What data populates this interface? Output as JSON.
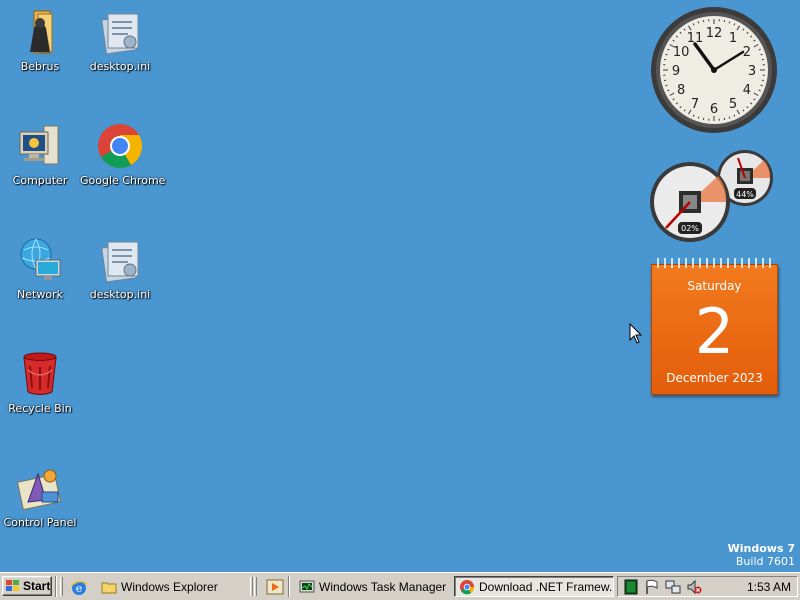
{
  "desktop_icons": [
    {
      "label": "Bebrus",
      "icon": "user-folder-icon"
    },
    {
      "label": "desktop.ini",
      "icon": "config-file-icon"
    },
    {
      "label": "Computer",
      "icon": "computer-icon"
    },
    {
      "label": "Google Chrome",
      "icon": "chrome-icon"
    },
    {
      "label": "Network",
      "icon": "network-icon"
    },
    {
      "label": "desktop.ini",
      "icon": "config-file-icon"
    },
    {
      "label": "Recycle Bin",
      "icon": "recycle-bin-icon"
    },
    {
      "label": "Control Panel",
      "icon": "control-panel-icon"
    }
  ],
  "gadgets": {
    "clock": {
      "hour_numbers": [
        "12",
        "1",
        "2",
        "3",
        "4",
        "5",
        "6",
        "7",
        "8",
        "9",
        "10",
        "11"
      ]
    },
    "cpu_meter": {
      "cpu_percent": "02%",
      "memory_percent": "44%"
    },
    "calendar": {
      "weekday": "Saturday",
      "day": "2",
      "month_year": "December 2023",
      "color": "#ee6e17"
    }
  },
  "watermark": {
    "os": "Windows 7",
    "build": "Build 7601"
  },
  "taskbar": {
    "start_label": "Start",
    "tasks": [
      {
        "label": "Windows Explorer",
        "icon": "folder-icon"
      },
      {
        "label": "Windows Task Manager",
        "icon": "task-manager-icon"
      },
      {
        "label": "Download .NET Framew...",
        "icon": "chrome-icon"
      }
    ],
    "tray": {
      "icons": [
        "cmd-icon",
        "action-center-flag-icon",
        "network-tray-icon",
        "volume-muted-icon"
      ],
      "time": "1:53 AM"
    }
  },
  "colors": {
    "desktop": "#4996d1",
    "taskbar": "#d4d0c8",
    "calendar": "#ee6e17"
  }
}
